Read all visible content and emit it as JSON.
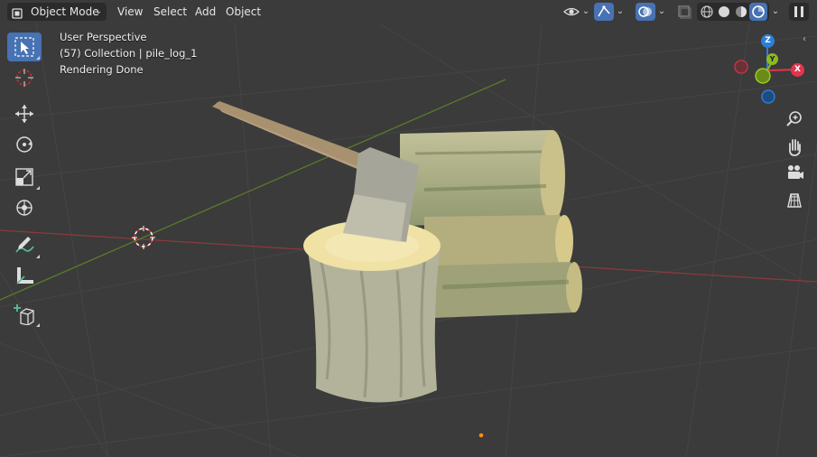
{
  "header": {
    "mode_label": "Object Mode",
    "menus": [
      "View",
      "Select",
      "Add",
      "Object"
    ]
  },
  "viewport": {
    "perspective_label": "User Perspective",
    "collection_label": "(57) Collection | pile_log_1",
    "status_label": "Rendering Done"
  },
  "gizmo": {
    "z": "Z",
    "y": "Y",
    "x": "X"
  },
  "toolbar": [
    {
      "name": "select-box-tool",
      "icon": "select-cursor-icon",
      "active": true
    },
    {
      "name": "cursor-tool",
      "icon": "3d-cursor-icon",
      "active": false
    },
    {
      "name": "move-tool",
      "icon": "move-arrows-icon",
      "active": false
    },
    {
      "name": "rotate-tool",
      "icon": "rotate-icon",
      "active": false
    },
    {
      "name": "scale-tool",
      "icon": "scale-icon",
      "active": false
    },
    {
      "name": "transform-tool",
      "icon": "transform-icon",
      "active": false
    },
    {
      "name": "annotate-tool",
      "icon": "annotate-pencil-icon",
      "active": false
    },
    {
      "name": "measure-tool",
      "icon": "measure-ruler-icon",
      "active": false
    },
    {
      "name": "add-cube-tool",
      "icon": "add-cube-icon",
      "active": false
    }
  ],
  "colors": {
    "accent": "#4772b3",
    "axis_x": "#e2354f",
    "axis_y": "#8bbb20",
    "axis_z": "#2d7fd6",
    "grid_x_line": "#8a3a3a",
    "grid_y_line": "#5a7a2a"
  }
}
